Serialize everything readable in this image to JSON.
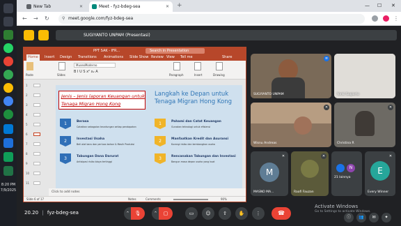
{
  "taskbar": {
    "time": "8:20 PM",
    "date": "7/9/2025"
  },
  "browser": {
    "tabs": [
      {
        "label": "New Tab",
        "active": false
      },
      {
        "label": "Meet - fyz-bdeg-sea",
        "active": true
      }
    ],
    "url": "meet.google.com/fyz-bdeg-sea"
  },
  "meet": {
    "presenter_label": "SUGIYANTO UNPAM (Presentasi)",
    "meeting_time": "20.20",
    "meeting_code": "fyz-bdeg-sea",
    "activate_title": "Activate Windows",
    "activate_sub": "Go to Settings to activate Windows."
  },
  "ppt": {
    "doc_title": "PPT SAK - IFR...",
    "search_placeholder": "Search in Presentation",
    "share_label": "Share",
    "menu": [
      "Home",
      "Insert",
      "Design",
      "Transitions",
      "Animations",
      "Slide Show",
      "Review",
      "View",
      "Tell me"
    ],
    "ribbon": {
      "paste": "Paste",
      "slides": "Slides",
      "font": "MuseoModerno",
      "paragraph": "Paragraph",
      "insert": "Insert",
      "drawing": "Drawing"
    },
    "thumb_numbers": [
      "1",
      "2",
      "3",
      "4",
      "5",
      "6",
      "7",
      "8",
      "9",
      "10",
      "11"
    ],
    "notes_placeholder": "Click to add notes",
    "status": {
      "slide_info": "Slide 6 of 17",
      "notes": "Notes",
      "comments": "Comments",
      "zoom": "90%"
    },
    "slide": {
      "title_left": "Jenis – Jenis laporan Keuangan untuk Tenaga Migran Hong Kong",
      "title_right": "Langkah ke Depan untuk Tenaga Migran Hong Kong",
      "left_items": [
        {
          "num": "1",
          "head": "Berasa",
          "desc": "Catatkan sebagaian keuntungan setiap pendapatan"
        },
        {
          "num": "2",
          "head": "Investasi Usaha",
          "desc": "Beli alat baru dan perluas bahan & Masih Produksi"
        },
        {
          "num": "3",
          "head": "Tabungan Dana Darurat",
          "desc": "Antisipasi risiko biaya tertinggi"
        }
      ],
      "right_items": [
        {
          "num": "1",
          "head": "Pahami dan Catat Keuangan",
          "desc": "Gunakan teknologi untuk efisiensi"
        },
        {
          "num": "2",
          "head": "Manfaatkan Kredit dan Asuransi",
          "desc": "Kurangi risiko dan kembangkan usaha"
        },
        {
          "num": "3",
          "head": "Rencanakan Tabungan dan Investasi",
          "desc": "Bangun masa depan usaha yang kuat"
        }
      ]
    }
  },
  "participants": [
    {
      "name": "SUGIYANTO UNPAM",
      "type": "video"
    },
    {
      "name": "Yonki Sugiarto",
      "type": "video"
    },
    {
      "name": "Wisnu Andreas",
      "type": "video"
    },
    {
      "name": "Christina R",
      "type": "video"
    },
    {
      "name": "MASNO MA...",
      "initial": "M",
      "type": "avatar"
    },
    {
      "name": "Raafi Fauzan",
      "type": "video"
    },
    {
      "name": "21 lainnya",
      "type": "others"
    },
    {
      "name": "Every Winner",
      "initial": "E",
      "type": "avatar"
    }
  ],
  "colors": {
    "ppt_accent": "#b7472a",
    "meet_bg": "#202124",
    "end_call": "#ea4335",
    "slide_bg": "#cfe0ee",
    "slide_title_red": "#c00000",
    "slide_title_blue": "#2e75b6"
  }
}
